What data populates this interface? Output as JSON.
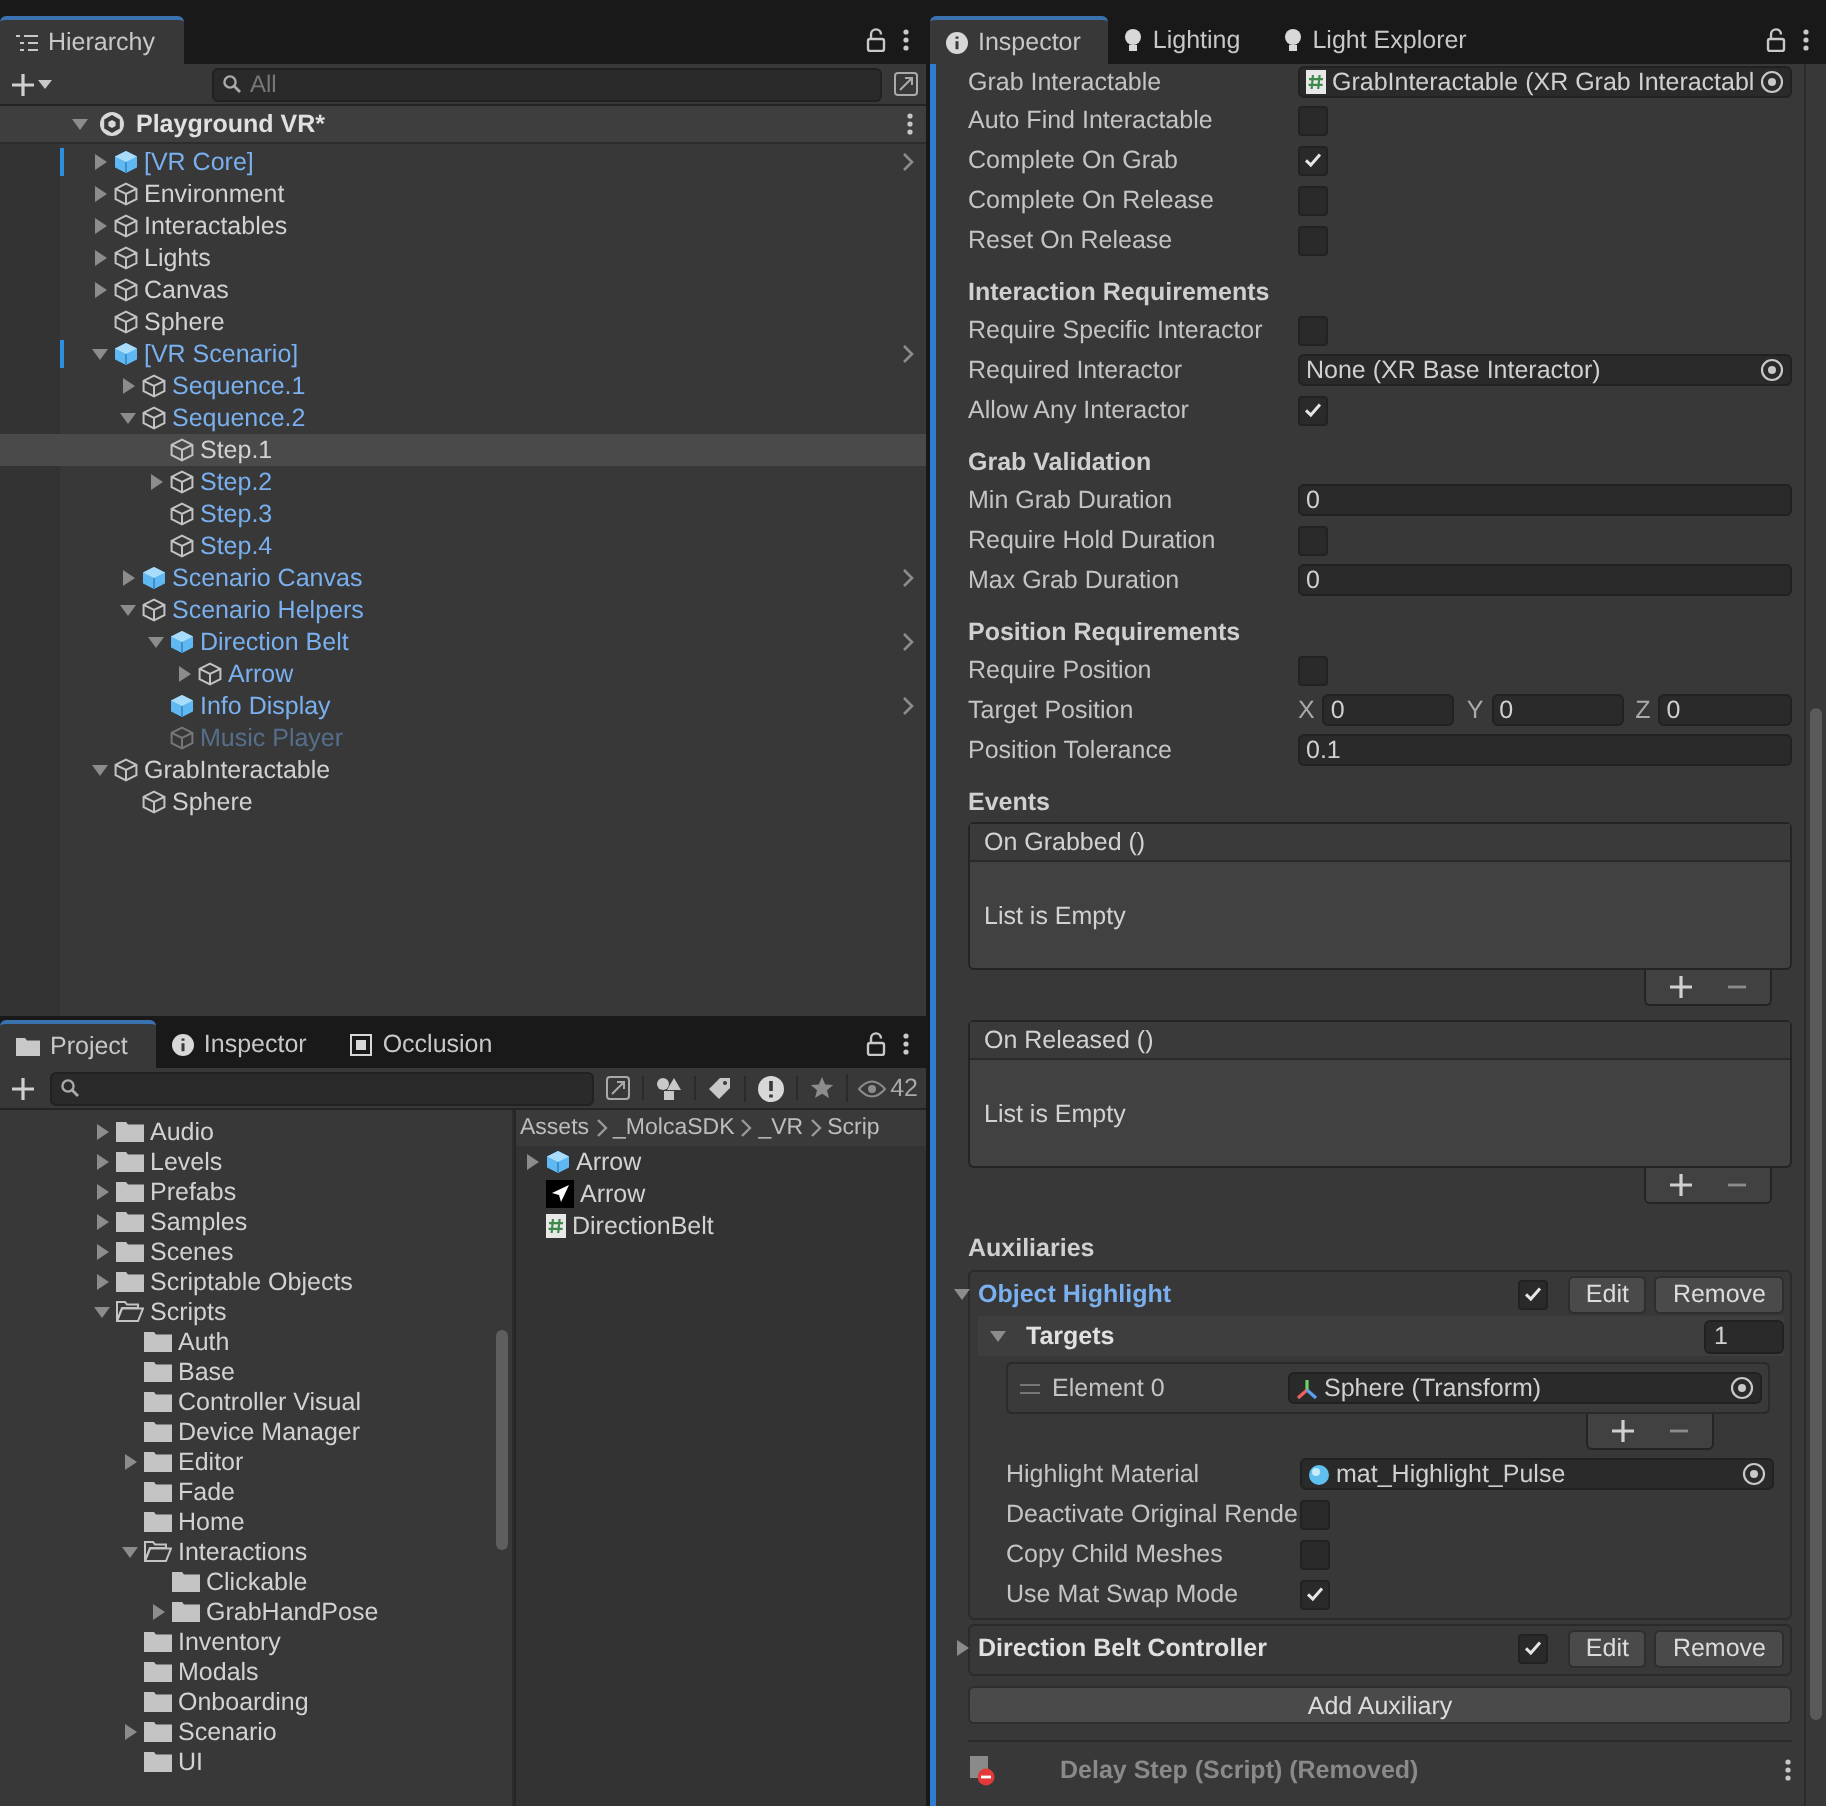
{
  "hierarchy": {
    "tab": "Hierarchy",
    "search": {
      "placeholder": "All"
    },
    "scene": "Playground VR*",
    "items": [
      {
        "name": "[VR Core]",
        "kind": "prefab-root",
        "marked": true,
        "expanded": false,
        "selected": false,
        "active": true
      },
      {
        "name": "Environment",
        "kind": "object",
        "marked": false,
        "expanded": false,
        "selected": false,
        "active": true
      },
      {
        "name": "Interactables",
        "kind": "object",
        "marked": false,
        "expanded": false,
        "selected": false,
        "active": true
      },
      {
        "name": "Lights",
        "kind": "object",
        "marked": false,
        "expanded": false,
        "selected": false,
        "active": true
      },
      {
        "name": "Canvas",
        "kind": "object",
        "marked": false,
        "expanded": false,
        "selected": false,
        "active": true
      },
      {
        "name": "Sphere",
        "kind": "object",
        "marked": false,
        "selected": false,
        "active": true
      },
      {
        "name": "[VR Scenario]",
        "kind": "prefab-root",
        "marked": true,
        "expanded": true,
        "selected": false,
        "active": true,
        "children": [
          {
            "name": "Sequence.1",
            "kind": "prefab-child",
            "marked": false,
            "expanded": false,
            "selected": false,
            "active": true
          },
          {
            "name": "Sequence.2",
            "kind": "prefab-child",
            "marked": false,
            "expanded": true,
            "selected": false,
            "active": true,
            "children": [
              {
                "name": "Step.1",
                "kind": "object",
                "marked": false,
                "selected": true,
                "active": true
              },
              {
                "name": "Step.2",
                "kind": "prefab-child",
                "marked": false,
                "expanded": false,
                "selected": false,
                "active": true
              },
              {
                "name": "Step.3",
                "kind": "prefab-child",
                "marked": false,
                "selected": false,
                "active": true
              },
              {
                "name": "Step.4",
                "kind": "prefab-child",
                "marked": false,
                "selected": false,
                "active": true
              }
            ]
          },
          {
            "name": "Scenario Canvas",
            "kind": "prefab-root",
            "marked": false,
            "expanded": false,
            "selected": false,
            "active": true
          },
          {
            "name": "Scenario Helpers",
            "kind": "prefab-child",
            "marked": false,
            "expanded": true,
            "selected": false,
            "active": true,
            "children": [
              {
                "name": "Direction Belt",
                "kind": "prefab-root",
                "marked": false,
                "expanded": true,
                "selected": false,
                "active": true,
                "children": [
                  {
                    "name": "Arrow",
                    "kind": "prefab-child",
                    "marked": false,
                    "expanded": false,
                    "selected": false,
                    "active": true
                  }
                ]
              },
              {
                "name": "Info Display",
                "kind": "prefab-root",
                "marked": false,
                "selected": false,
                "active": true
              },
              {
                "name": "Music Player",
                "kind": "prefab-child",
                "marked": false,
                "selected": false,
                "active": false
              }
            ]
          }
        ]
      },
      {
        "name": "GrabInteractable",
        "kind": "object",
        "marked": false,
        "expanded": true,
        "selected": false,
        "active": true,
        "children": [
          {
            "name": "Sphere",
            "kind": "object",
            "marked": false,
            "selected": false,
            "active": true
          }
        ]
      }
    ]
  },
  "project": {
    "tabs": [
      {
        "label": "Project",
        "kind": "folder",
        "selected": true
      },
      {
        "label": "Inspector",
        "kind": "info",
        "selected": false
      },
      {
        "label": "Occlusion",
        "kind": "occlusion",
        "selected": false
      }
    ],
    "count": "42",
    "folders": [
      {
        "name": "Audio",
        "expanded": false
      },
      {
        "name": "Levels",
        "expanded": false
      },
      {
        "name": "Prefabs",
        "expanded": false
      },
      {
        "name": "Samples",
        "expanded": false
      },
      {
        "name": "Scenes",
        "expanded": false
      },
      {
        "name": "Scriptable Objects",
        "expanded": false
      },
      {
        "name": "Scripts",
        "expanded": true,
        "children": [
          {
            "name": "Auth"
          },
          {
            "name": "Base"
          },
          {
            "name": "Controller Visual"
          },
          {
            "name": "Device Manager"
          },
          {
            "name": "Editor",
            "expanded": false
          },
          {
            "name": "Fade"
          },
          {
            "name": "Home"
          },
          {
            "name": "Interactions",
            "expanded": true,
            "children": [
              {
                "name": "Clickable"
              },
              {
                "name": "GrabHandPose",
                "expanded": false
              }
            ]
          },
          {
            "name": "Inventory"
          },
          {
            "name": "Modals"
          },
          {
            "name": "Onboarding"
          },
          {
            "name": "Scenario",
            "expanded": false
          },
          {
            "name": "UI"
          }
        ]
      }
    ],
    "breadcrumb": [
      "Assets",
      "_MolcaSDK",
      "_VR",
      "Scrip"
    ],
    "assets": [
      {
        "name": "Arrow",
        "kind": "prefab",
        "expanded": false
      },
      {
        "name": "Arrow",
        "kind": "sprite"
      },
      {
        "name": "DirectionBelt",
        "kind": "script"
      }
    ]
  },
  "inspector": {
    "tabs": [
      {
        "label": "Inspector",
        "kind": "info",
        "selected": true
      },
      {
        "label": "Lighting",
        "kind": "bulb",
        "selected": false
      },
      {
        "label": "Light Explorer",
        "kind": "bulb",
        "selected": false
      }
    ],
    "fields": [
      {
        "kind": "script-field",
        "label": "Grab Interactable",
        "value": "GrabInteractable (XR Grab Interactabl"
      },
      {
        "kind": "checkbox",
        "label": "Auto Find Interactable",
        "checked": false
      },
      {
        "kind": "checkbox",
        "label": "Complete On Grab",
        "checked": true
      },
      {
        "kind": "checkbox",
        "label": "Complete On Release",
        "checked": false
      },
      {
        "kind": "checkbox",
        "label": "Reset On Release",
        "checked": false
      },
      {
        "kind": "header",
        "label": "Interaction Requirements"
      },
      {
        "kind": "checkbox",
        "label": "Require Specific Interactor",
        "checked": false
      },
      {
        "kind": "object-field",
        "label": "Required Interactor",
        "value": "None (XR Base Interactor)"
      },
      {
        "kind": "checkbox",
        "label": "Allow Any Interactor",
        "checked": true
      },
      {
        "kind": "header",
        "label": "Grab Validation"
      },
      {
        "kind": "number",
        "label": "Min Grab Duration",
        "value": "0"
      },
      {
        "kind": "checkbox",
        "label": "Require Hold Duration",
        "checked": false
      },
      {
        "kind": "number",
        "label": "Max Grab Duration",
        "value": "0"
      },
      {
        "kind": "header",
        "label": "Position Requirements"
      },
      {
        "kind": "checkbox",
        "label": "Require Position",
        "checked": false
      },
      {
        "kind": "vector3",
        "label": "Target Position",
        "axes": [
          {
            "axis": "X",
            "value": "0"
          },
          {
            "axis": "Y",
            "value": "0"
          },
          {
            "axis": "Z",
            "value": "0"
          }
        ]
      },
      {
        "kind": "number",
        "label": "Position Tolerance",
        "value": "0.1"
      },
      {
        "kind": "header",
        "label": "Events"
      },
      {
        "kind": "event",
        "label": "On Grabbed ()",
        "empty_text": "List is Empty"
      },
      {
        "kind": "event",
        "label": "On Released ()",
        "empty_text": "List is Empty"
      },
      {
        "kind": "header",
        "label": "Auxiliaries"
      }
    ],
    "auxiliaries": [
      {
        "title": "Object Highlight",
        "modified": true,
        "expanded": true,
        "enabled": true,
        "buttons": [
          "Edit",
          "Remove"
        ],
        "targets": {
          "label": "Targets",
          "count": "1",
          "expanded": true,
          "elements": [
            {
              "label": "Element 0",
              "value": "Sphere (Transform)",
              "kind": "transform-field"
            }
          ]
        },
        "fields": [
          {
            "kind": "material-field",
            "label": "Highlight Material",
            "value": "mat_Highlight_Pulse"
          },
          {
            "kind": "checkbox",
            "label": "Deactivate Original Rende",
            "checked": false
          },
          {
            "kind": "checkbox",
            "label": "Copy Child Meshes",
            "checked": false
          },
          {
            "kind": "checkbox",
            "label": "Use Mat Swap Mode",
            "checked": true
          }
        ]
      },
      {
        "title": "Direction Belt Controller",
        "modified": false,
        "expanded": false,
        "enabled": true,
        "buttons": [
          "Edit",
          "Remove"
        ]
      }
    ],
    "add_button": "Add Auxiliary",
    "removed_component": "Delay Step (Script) (Removed)"
  }
}
